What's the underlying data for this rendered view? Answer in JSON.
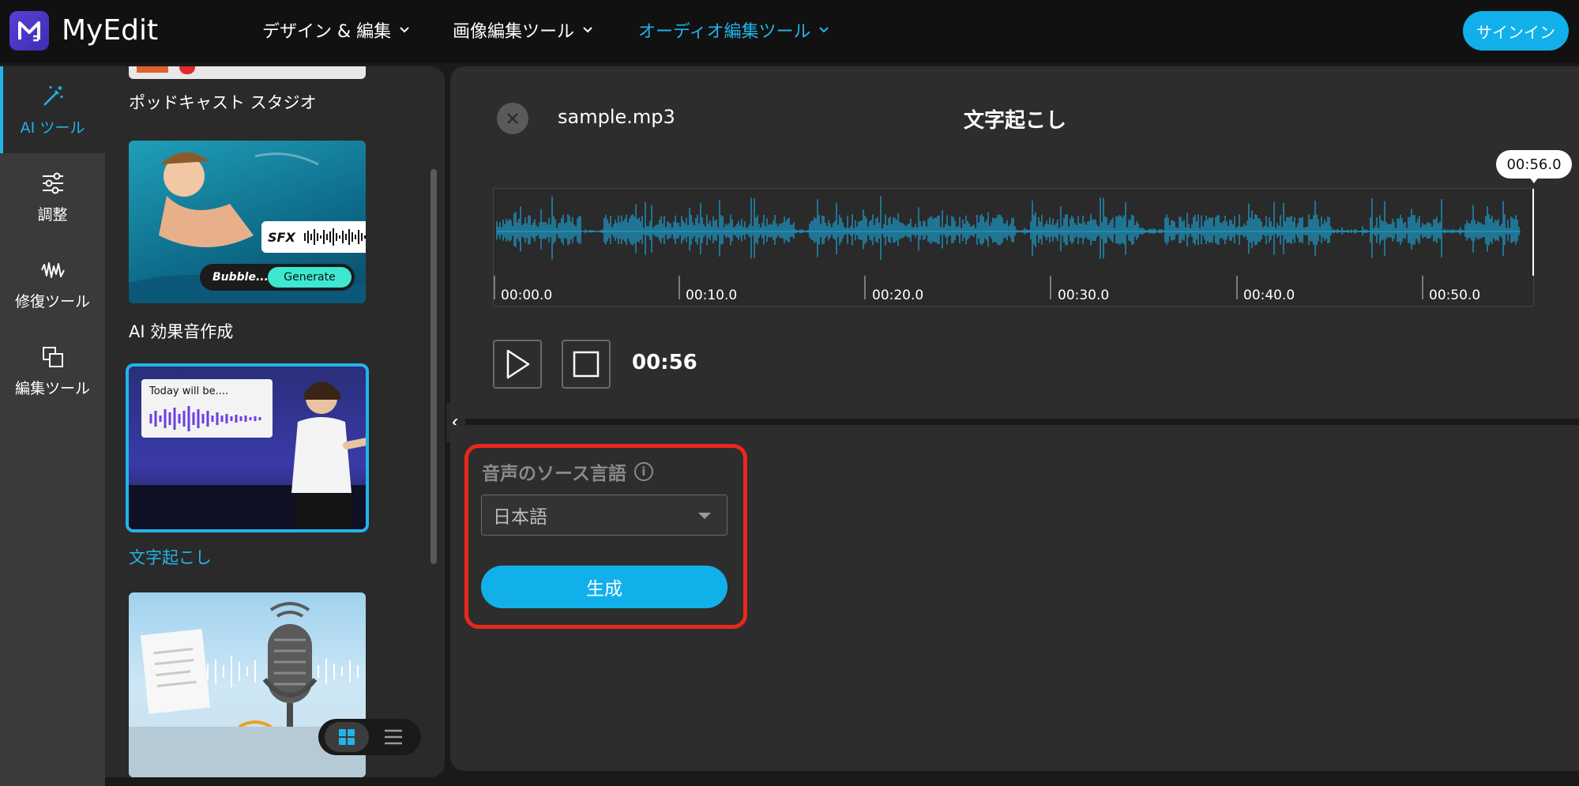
{
  "app": {
    "name": "MyEdit",
    "accent": "#12b0ea"
  },
  "nav": [
    {
      "label": "デザイン & 編集",
      "active": false
    },
    {
      "label": "画像編集ツール",
      "active": false
    },
    {
      "label": "オーディオ編集ツール",
      "active": true
    }
  ],
  "signin_label": "サインイン",
  "rail": [
    {
      "label": "AI ツール",
      "icon": "magic-wand-icon",
      "active": true
    },
    {
      "label": "調整",
      "icon": "sliders-icon",
      "active": false
    },
    {
      "label": "修復ツール",
      "icon": "waveform-repair-icon",
      "active": false
    },
    {
      "label": "編集ツール",
      "icon": "layers-icon",
      "active": false
    }
  ],
  "tools": [
    {
      "label": "ポッドキャスト スタジオ",
      "active": false
    },
    {
      "label": "AI 効果音作成",
      "active": false,
      "thumb_text_sfx": "SFX",
      "thumb_text_input": "Bubble...",
      "thumb_button": "Generate"
    },
    {
      "label": "文字起こし",
      "active": true,
      "thumb_text": "Today will be...."
    },
    {
      "label": "",
      "active": false
    }
  ],
  "editor": {
    "filename": "sample.mp3",
    "title": "文字起こし",
    "playhead_time": "00:56.0",
    "ticks": [
      "00:00.0",
      "00:10.0",
      "00:20.0",
      "00:30.0",
      "00:40.0",
      "00:50.0"
    ],
    "time_readout": "00:56",
    "waveform_color": "#1ca6d9"
  },
  "settings": {
    "language_label": "音声のソース言語",
    "language_value": "日本語",
    "generate_label": "生成"
  }
}
